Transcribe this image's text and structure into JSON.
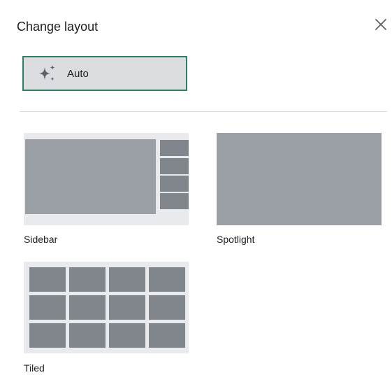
{
  "dialog": {
    "title": "Change layout",
    "close_icon": "close-icon"
  },
  "auto_option": {
    "label": "Auto",
    "icon": "sparkle-icon",
    "selected": true
  },
  "layouts": [
    {
      "id": "sidebar",
      "label": "Sidebar"
    },
    {
      "id": "spotlight",
      "label": "Spotlight"
    },
    {
      "id": "tiled",
      "label": "Tiled"
    }
  ],
  "colors": {
    "selected_border": "#2f7e68",
    "selected_fill": "#dadce0",
    "preview_background": "#e8eaed",
    "primary_tile": "#9aa0a6",
    "secondary_tile": "#80868b"
  }
}
